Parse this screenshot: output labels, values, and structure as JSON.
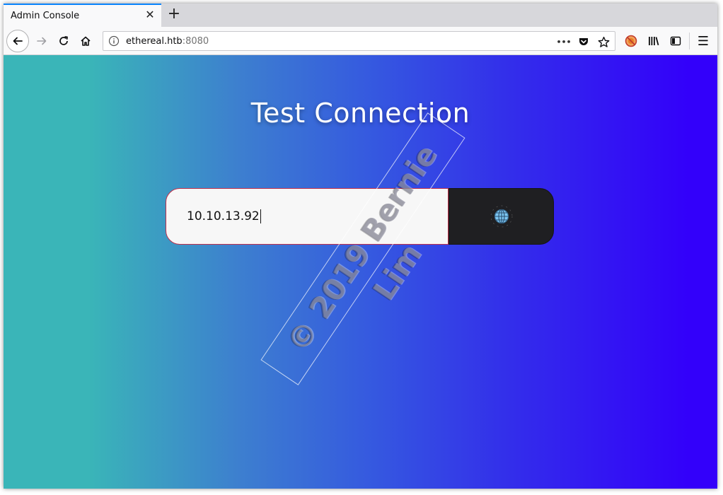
{
  "browser": {
    "tab_title": "Admin Console",
    "tab_close": "✕",
    "new_tab": "+",
    "url_host": "ethereal.htb",
    "url_port": ":8080",
    "more_actions": "•••",
    "menu": "☰"
  },
  "page": {
    "title": "Test Connection",
    "input_value": "10.10.13.92",
    "watermark": "© 2019 Bernie Lim"
  },
  "colors": {
    "accent_tab": "#0a84ff",
    "gradient_start": "#3ab5b8",
    "gradient_end": "#3300fa",
    "button_bg": "#1f1f22",
    "input_border": "#c0304b",
    "globe_icon": "#7cc6f2"
  },
  "icons": [
    "back-arrow-icon",
    "forward-arrow-icon",
    "reload-icon",
    "home-icon",
    "info-icon",
    "pocket-icon",
    "star-icon",
    "blocked-addon-icon",
    "library-icon",
    "sidebar-icon",
    "hamburger-menu-icon",
    "globe-icon"
  ]
}
